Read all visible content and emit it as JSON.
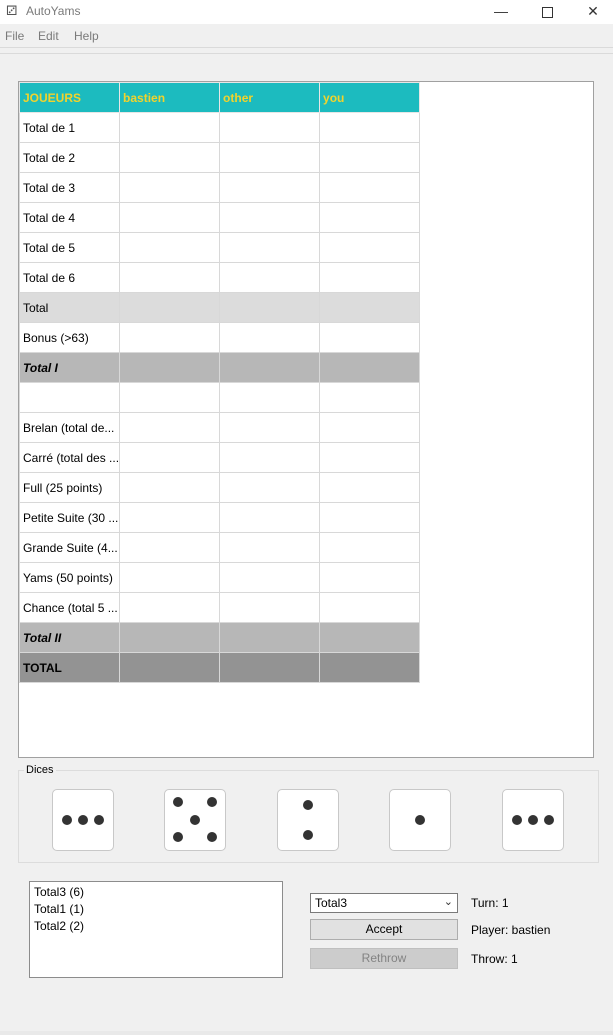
{
  "window": {
    "title": "AutoYams",
    "icon": "dice-icon",
    "controls": {
      "minimize": "—",
      "maximize": "",
      "close": "✕"
    }
  },
  "menu": [
    "File",
    "Edit",
    "Help"
  ],
  "score_table": {
    "headers": [
      "JOUEURS",
      "bastien",
      "other",
      "you"
    ],
    "rows": [
      {
        "label": "Total de 1",
        "style": "normal"
      },
      {
        "label": "Total de 2",
        "style": "normal"
      },
      {
        "label": "Total de 3",
        "style": "normal"
      },
      {
        "label": "Total de 4",
        "style": "normal"
      },
      {
        "label": "Total de 5",
        "style": "normal"
      },
      {
        "label": "Total de 6",
        "style": "normal"
      },
      {
        "label": "Total",
        "style": "subtotal"
      },
      {
        "label": "Bonus (>63)",
        "style": "normal"
      },
      {
        "label": "Total I",
        "style": "total-i"
      },
      {
        "label": "",
        "style": "normal"
      },
      {
        "label": "Brelan (total de...",
        "style": "normal"
      },
      {
        "label": "Carré (total des ...",
        "style": "normal"
      },
      {
        "label": "Full (25 points)",
        "style": "normal"
      },
      {
        "label": "Petite Suite (30 ...",
        "style": "normal"
      },
      {
        "label": "Grande Suite (4...",
        "style": "normal"
      },
      {
        "label": "Yams (50 points)",
        "style": "normal"
      },
      {
        "label": "Chance (total 5 ...",
        "style": "normal"
      },
      {
        "label": "Total II",
        "style": "total-i"
      },
      {
        "label": "TOTAL",
        "style": "grand"
      }
    ],
    "colors": {
      "header_bg": "#1cbbbf",
      "header_text": "#f2d32b",
      "subtotal": "#dcdcdc",
      "total": "#b7b7b7",
      "grand_total": "#939393"
    }
  },
  "dices": {
    "legend": "Dices",
    "values": [
      3,
      5,
      2,
      1,
      3
    ]
  },
  "history": [
    "Total3 (6)",
    "Total1 (1)",
    "Total2 (2)"
  ],
  "controls": {
    "category_selected": "Total3",
    "accept_label": "Accept",
    "rethrow_label": "Rethrow",
    "turn": "Turn: 1",
    "player": "Player: bastien",
    "throw": "Throw: 1"
  }
}
